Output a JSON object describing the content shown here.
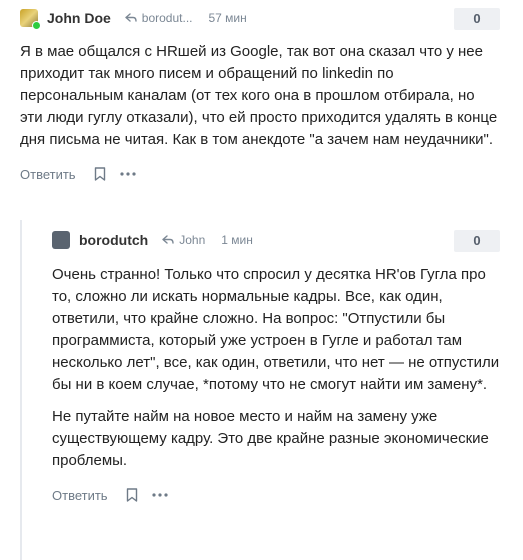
{
  "comments": [
    {
      "author": "John Doe",
      "reply_to": "borodut...",
      "time": "57 мин",
      "score": "0",
      "paragraphs": [
        "Я в мае общался с HRшей из Google, так вот она сказал что у нее приходит так много писем и обращений по linkedin по персональным каналам (от тех кого она в прошлом отбирала, но эти люди гуглу отказали), что ей просто приходится удалять в конце дня письма не читая. Как в том анекдоте \"а зачем нам неудачники\"."
      ],
      "reply_label": "Ответить"
    },
    {
      "author": "borodutch",
      "reply_to": "John",
      "time": "1 мин",
      "score": "0",
      "paragraphs": [
        "Очень странно! Только что спросил у десятка HR'ов Гугла про то, сложно ли искать нормальные кадры. Все, как один, ответили, что крайне сложно. На вопрос: \"Отпустили бы программиста, который уже устроен в Гугле и работал там несколько лет\", все, как один, ответили, что нет — не отпустили бы ни в коем случае, *потому что не смогут найти им замену*.",
        "Не путайте найм на новое место и найм на замену уже существующему кадру. Это две крайне разные экономические проблемы."
      ],
      "reply_label": "Ответить"
    }
  ],
  "icons": {
    "reply_arrow": "reply-arrow-icon",
    "bookmark": "bookmark-icon",
    "more": "more-dots-icon",
    "online": "online-indicator"
  },
  "colors": {
    "meta_text": "#7b8794",
    "score_bg": "#eef0f3",
    "online": "#2ecc40"
  }
}
